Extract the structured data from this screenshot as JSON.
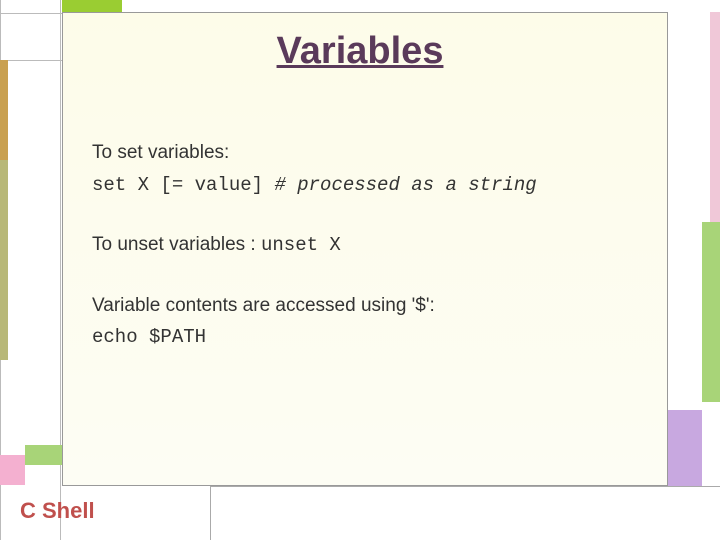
{
  "title": "Variables",
  "blocks": {
    "set": {
      "intro": "To set variables:",
      "code": "set X [= value] ",
      "comment": "# processed as a string"
    },
    "unset": {
      "intro": "To unset variables : ",
      "code": "unset X"
    },
    "access": {
      "intro_pre": "Variable contents are accessed using ",
      "intro_sym": "'$'",
      "intro_post": ":",
      "code": "echo $PATH"
    }
  },
  "footer": "C Shell"
}
